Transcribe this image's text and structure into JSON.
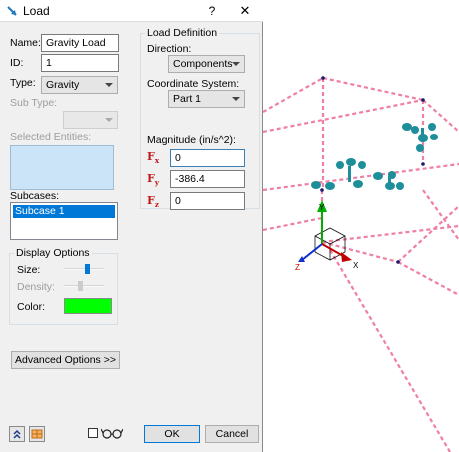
{
  "dialog": {
    "title": "Load",
    "help": "?",
    "close": "✕",
    "name_label": "Name:",
    "name_value": "Gravity Load",
    "id_label": "ID:",
    "id_value": "1",
    "type_label": "Type:",
    "type_value": "Gravity",
    "subtype_label": "Sub Type:",
    "subtype_value": "",
    "selected_entities_label": "Selected Entities:",
    "subcases_label": "Subcases:",
    "subcases": [
      "Subcase 1"
    ],
    "display_options": {
      "title": "Display Options",
      "size_label": "Size:",
      "size_level": 0.6,
      "density_label": "Density:",
      "density_level": 0.4,
      "color_label": "Color:",
      "color": "#00ff00"
    },
    "advanced_button": "Advanced Options >>",
    "ok_button": "OK",
    "cancel_button": "Cancel",
    "load_definition": {
      "title": "Load Definition",
      "direction_label": "Direction:",
      "direction_value": "Components",
      "coord_label": "Coordinate System:",
      "coord_value": "Part 1",
      "magnitude_label": "Magnitude (in/s^2):",
      "fx_label": "F",
      "fx_sub": "x",
      "fx_value": "0",
      "fy_label": "F",
      "fy_sub": "y",
      "fy_value": "-386.4",
      "fz_label": "F",
      "fz_sub": "z",
      "fz_value": "0"
    }
  },
  "axes": {
    "x_label": "X",
    "y_label": "Y",
    "z_label": "Z"
  },
  "colors": {
    "accent": "#0078d7",
    "mesh": "#ef7fa6",
    "arrow": "#1e8f9a",
    "force_label": "#c01818"
  },
  "icons": [
    "load-icon",
    "collapse-icon",
    "table-icon",
    "glasses-icon"
  ]
}
